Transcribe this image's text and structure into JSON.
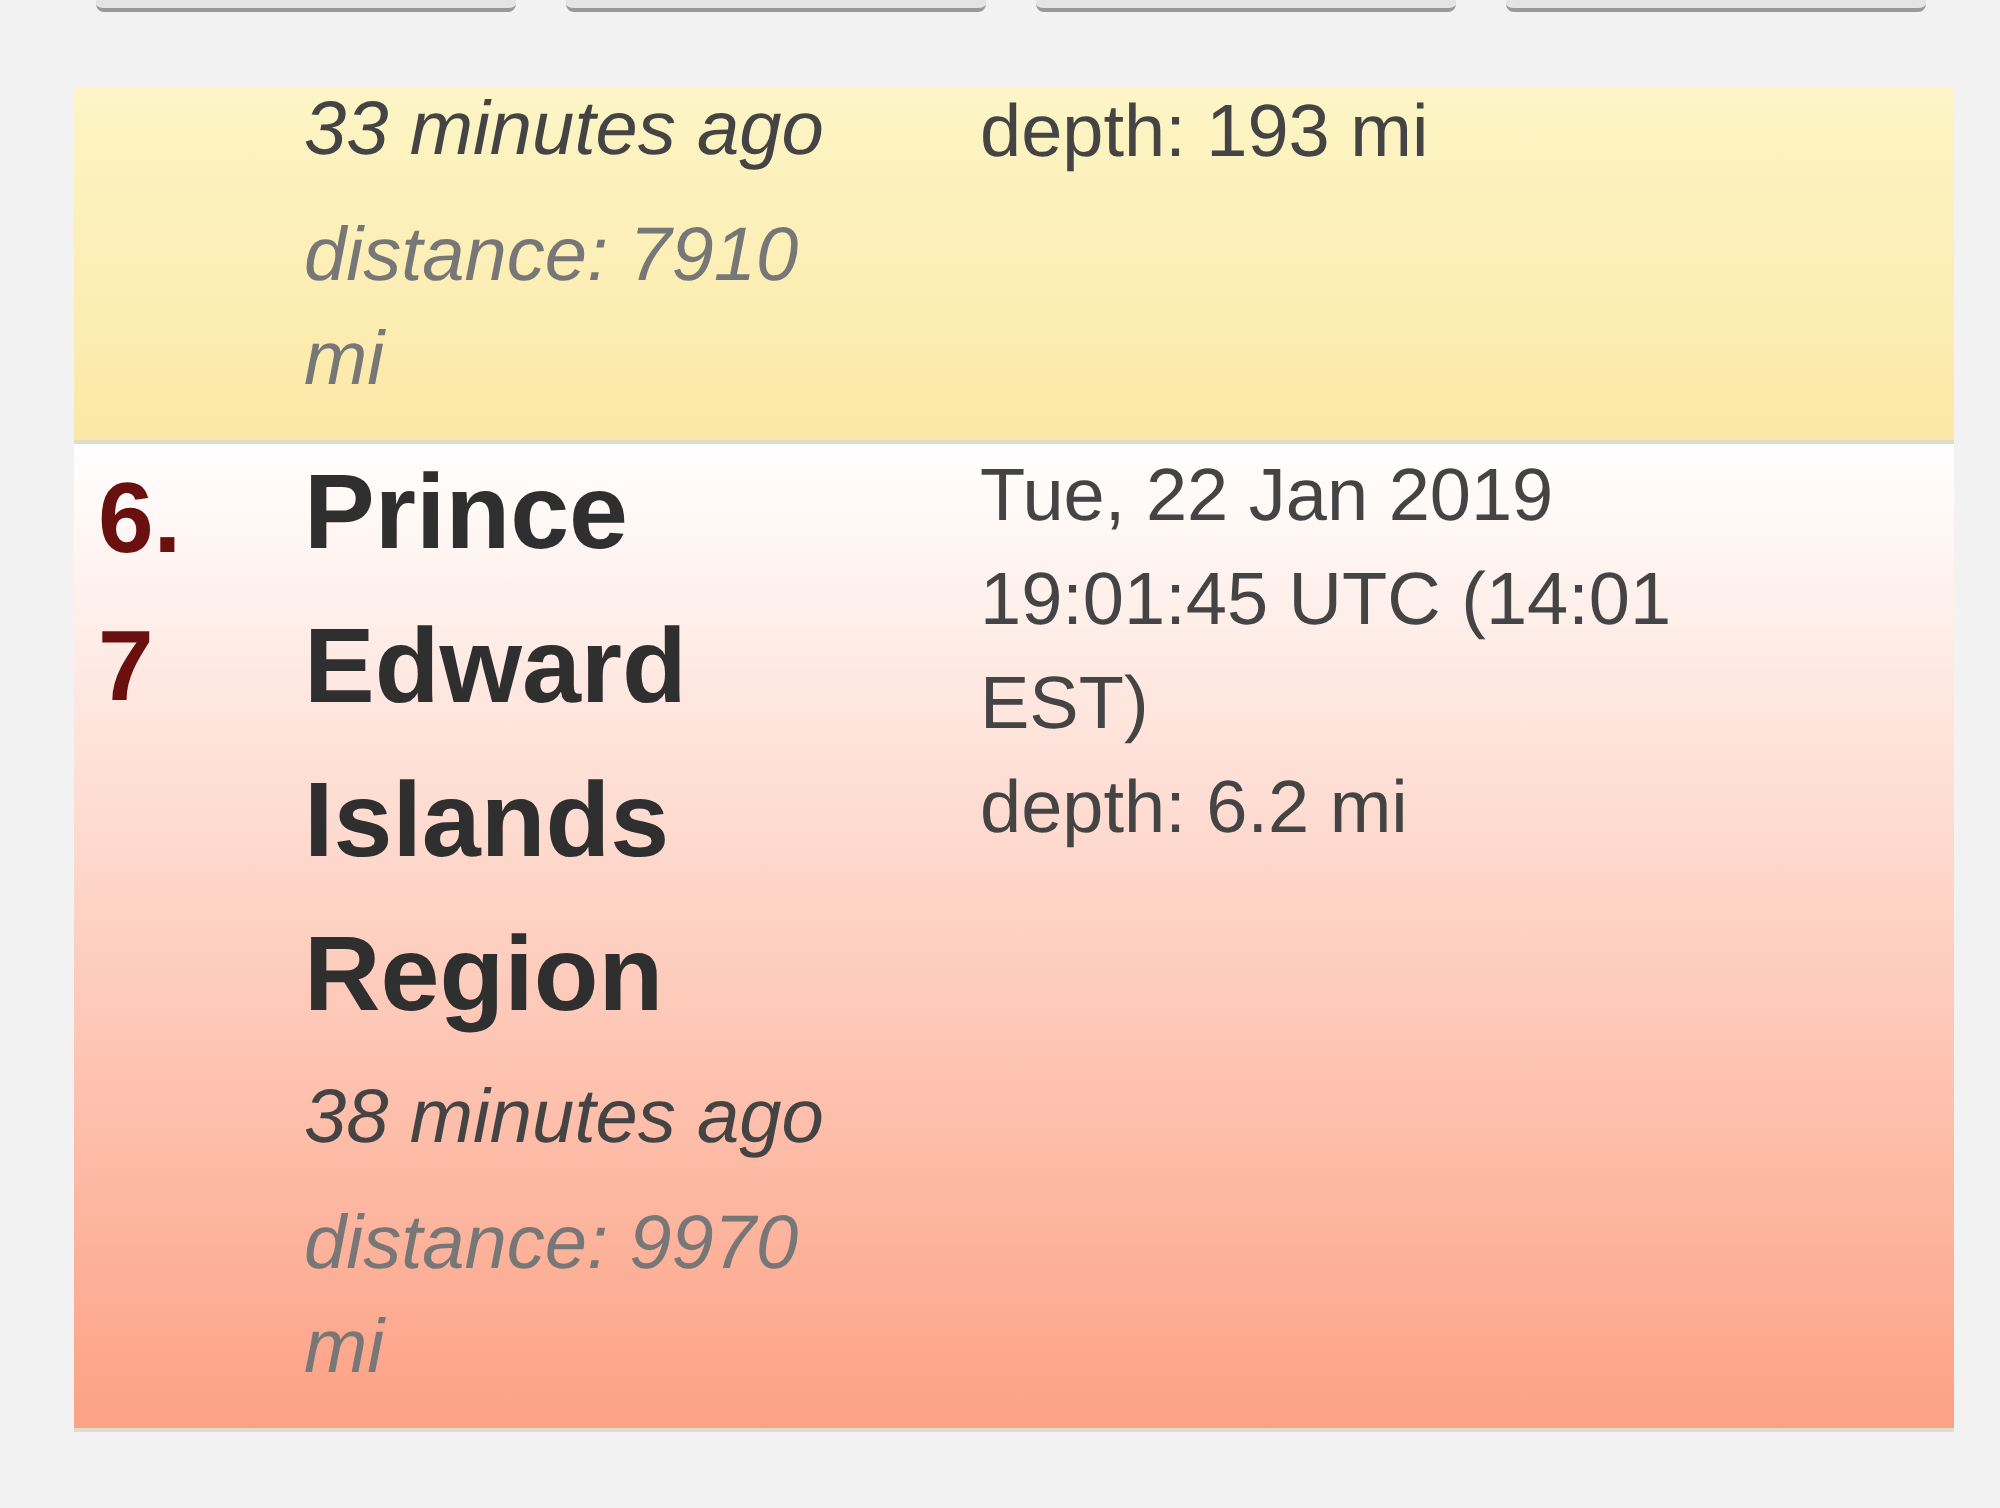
{
  "filter_buttons": [
    {
      "kind": "button"
    },
    {
      "kind": "button"
    },
    {
      "kind": "button"
    },
    {
      "kind": "button"
    }
  ],
  "quakes": [
    {
      "color": "#fbe8a6",
      "time_ago": "33 minutes ago",
      "distance": "distance: 7910 mi",
      "depth": "depth: 193 mi"
    },
    {
      "color": "#fca184",
      "magnitude": "6.7",
      "region": "Prince Edward Islands Region",
      "time_ago": "38 minutes ago",
      "distance": "distance: 9970 mi",
      "datetime": "Tue, 22 Jan 2019 19:01:45 UTC (14:01 EST)",
      "depth": "depth: 6.2 mi"
    }
  ]
}
